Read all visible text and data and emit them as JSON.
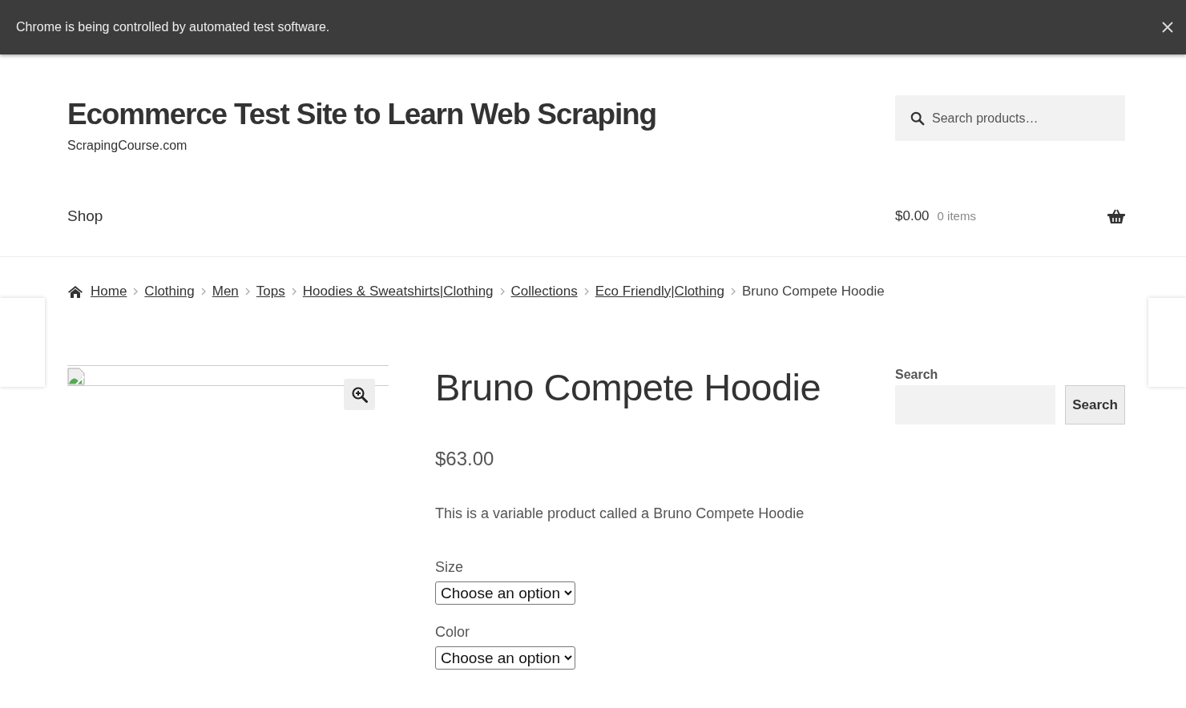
{
  "automation_banner": {
    "message": "Chrome is being controlled by automated test software."
  },
  "header": {
    "site_title": "Ecommerce Test Site to Learn Web Scraping",
    "tagline": "ScrapingCourse.com",
    "search": {
      "placeholder": "Search products…"
    }
  },
  "nav": {
    "items": [
      {
        "label": "Shop"
      }
    ],
    "cart": {
      "total": "$0.00",
      "count": "0 items"
    }
  },
  "breadcrumb": [
    {
      "label": "Home",
      "kind": "home"
    },
    {
      "label": "Clothing",
      "kind": "link"
    },
    {
      "label": "Men",
      "kind": "link"
    },
    {
      "label": "Tops",
      "kind": "link"
    },
    {
      "label": "Hoodies & Sweatshirts|Clothing",
      "kind": "link"
    },
    {
      "label": "Collections",
      "kind": "link"
    },
    {
      "label": "Eco Friendly|Clothing",
      "kind": "link"
    },
    {
      "label": "Bruno Compete Hoodie",
      "kind": "current"
    }
  ],
  "product": {
    "title": "Bruno Compete Hoodie",
    "price": "$63.00",
    "description": "This is a variable product called a Bruno Compete Hoodie",
    "attributes": [
      {
        "label": "Size",
        "value": "Choose an option"
      },
      {
        "label": "Color",
        "value": "Choose an option"
      }
    ]
  },
  "sidebar": {
    "search": {
      "label": "Search",
      "button": "Search"
    }
  }
}
